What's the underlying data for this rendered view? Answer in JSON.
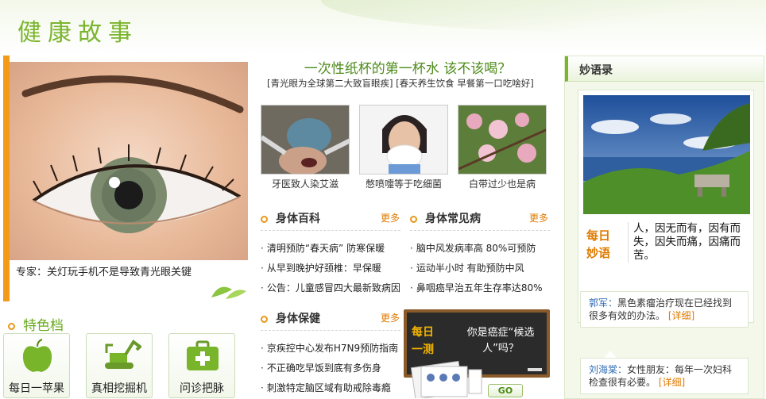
{
  "header": {
    "title": "健康故事"
  },
  "hero": {
    "caption": "专家：关灯玩手机不是导致青光眼关键"
  },
  "featured": {
    "title": "特色档",
    "cards": [
      {
        "label": "每日一苹果",
        "icon": "apple-icon"
      },
      {
        "label": "真相挖掘机",
        "icon": "excavator-icon"
      },
      {
        "label": "问诊把脉",
        "icon": "medical-kit-icon"
      }
    ]
  },
  "main": {
    "headline": "一次性纸杯的第一杯水 该不该喝？",
    "sublinks": "[青光眼为全球第二大致盲眼疾] [春天养生饮食 早餐第一口吃啥好]",
    "thumbs": [
      {
        "caption": "牙医致人染艾滋"
      },
      {
        "caption": "憋喷嚏等于吃细菌"
      },
      {
        "caption": "白带过少也是病"
      }
    ],
    "more_label": "更多",
    "sections": {
      "body_encyclopedia": {
        "title": "身体百科",
        "items": [
          "清明预防“春天病” 防寒保暖",
          "从早到晚护好颈椎：早保暖",
          "公告：儿童感冒四大最新致病因"
        ]
      },
      "common_diseases": {
        "title": "身体常见病",
        "items": [
          "脑中风发病率高 80%可预防",
          "运动半小时 有助预防中风",
          "鼻咽癌早治五年生存率达80%"
        ]
      },
      "body_care": {
        "title": "身体保健",
        "items": [
          "京疾控中心发布H7N9预防指南",
          "不正确吃早饭到底有多伤身",
          "刺激特定脑区域有助戒除毒瘾"
        ]
      }
    },
    "quiz": {
      "tag_line1": "每日",
      "tag_line2": "一测",
      "question": "你是癌症“候选人”吗？",
      "go_label": "GO"
    }
  },
  "sidebar": {
    "title": "妙语录",
    "quote": {
      "tag_line1": "每日",
      "tag_line2": "妙语",
      "text": "人，因无而有，因有而失，因失而痛，因痛而苦。"
    },
    "comments": [
      {
        "author": "郭军：",
        "text": "黑色素瘤治疗现在已经找到很多有效的办法。",
        "detail": "[详细]"
      },
      {
        "author": "刘海棠：",
        "text": "女性朋友：每年一次妇科检查很有必要。",
        "detail": "[详细]"
      }
    ]
  },
  "colors": {
    "brand_green": "#7bb52d",
    "accent_orange": "#e07b00",
    "frame_orange": "#f39a18"
  }
}
